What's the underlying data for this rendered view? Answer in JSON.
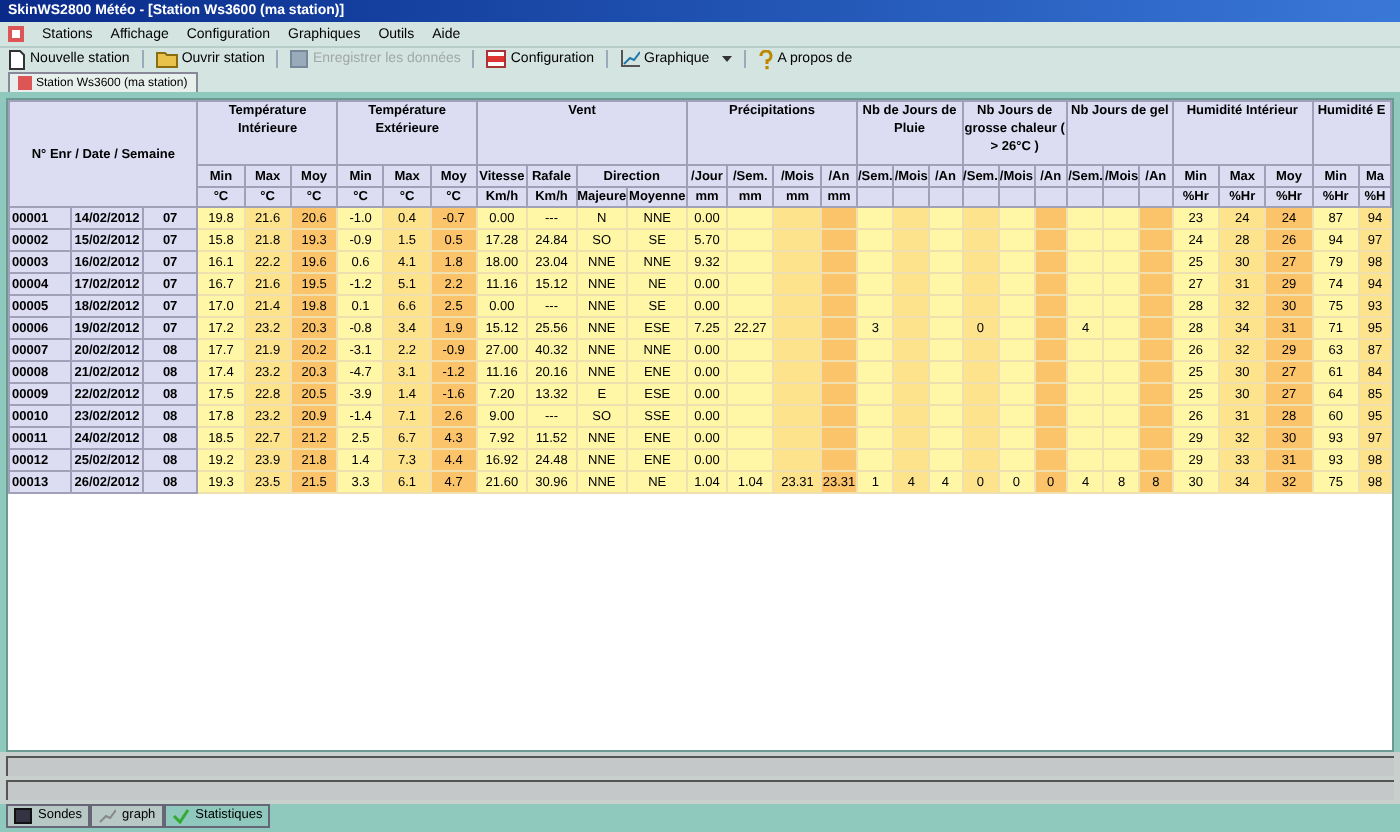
{
  "window": {
    "title": "SkinWS2800 Météo - [Station Ws3600 (ma station)]"
  },
  "menu": [
    "Stations",
    "Affichage",
    "Configuration",
    "Graphiques",
    "Outils",
    "Aide"
  ],
  "toolbar": [
    {
      "kind": "new",
      "label": "Nouvelle station",
      "disabled": false
    },
    {
      "kind": "open",
      "label": "Ouvrir station",
      "disabled": false
    },
    {
      "kind": "save",
      "label": "Enregistrer les données",
      "disabled": true
    },
    {
      "kind": "config",
      "label": "Configuration",
      "disabled": false
    },
    {
      "kind": "chart",
      "label": "Graphique",
      "disabled": false,
      "dropdown": true
    },
    {
      "kind": "help",
      "label": "A propos de",
      "disabled": false
    }
  ],
  "document_tab": "Station Ws3600 (ma station)",
  "table": {
    "id_header": "N° Enr / Date / Semaine",
    "groups": [
      {
        "title": "Température Intérieure",
        "columns": [
          {
            "label": "Min",
            "unit": "°C",
            "color": "#fff7a6"
          },
          {
            "label": "Max",
            "unit": "°C",
            "color": "#fde48c"
          },
          {
            "label": "Moy",
            "unit": "°C",
            "color": "#fbc36a"
          }
        ]
      },
      {
        "title": "Température Extérieure",
        "columns": [
          {
            "label": "Min",
            "unit": "°C",
            "color": "#fff7a6"
          },
          {
            "label": "Max",
            "unit": "°C",
            "color": "#fde48c"
          },
          {
            "label": "Moy",
            "unit": "°C",
            "color": "#fbc36a"
          }
        ]
      },
      {
        "title": "Vent",
        "columns": [
          {
            "label": "Vitesse",
            "unit": "Km/h",
            "color": "#fff7a6"
          },
          {
            "label": "Rafale",
            "unit": "Km/h",
            "color": "#fff7a6"
          },
          {
            "label": "Majeure",
            "span_label": "Direction",
            "color": "#fff7a6"
          },
          {
            "label": "Moyenne",
            "color": "#fff7a6"
          }
        ]
      },
      {
        "title": "Précipitations",
        "columns": [
          {
            "label": "/Jour",
            "unit": "mm",
            "color": "#fff7a6"
          },
          {
            "label": "/Sem.",
            "unit": "mm",
            "color": "#fff7a6"
          },
          {
            "label": "/Mois",
            "unit": "mm",
            "color": "#fde48c"
          },
          {
            "label": "/An",
            "unit": "mm",
            "color": "#fbc36a"
          }
        ]
      },
      {
        "title": "Nb de Jours de Pluie",
        "columns": [
          {
            "label": "/Sem.",
            "color": "#fff7a6"
          },
          {
            "label": "/Mois",
            "color": "#fde48c"
          },
          {
            "label": "/An",
            "color": "#fff7a6"
          }
        ]
      },
      {
        "title": "Nb Jours de grosse chaleur ( > 26°C )",
        "columns": [
          {
            "label": "/Sem.",
            "color": "#fde48c"
          },
          {
            "label": "/Mois",
            "color": "#fff7a6"
          },
          {
            "label": "/An",
            "color": "#fbc36a"
          }
        ]
      },
      {
        "title": "Nb Jours de gel",
        "columns": [
          {
            "label": "/Sem.",
            "color": "#fff7a6"
          },
          {
            "label": "/Mois",
            "color": "#fff7a6"
          },
          {
            "label": "/An",
            "color": "#fbc36a"
          }
        ]
      },
      {
        "title": "Humidité Intérieur",
        "columns": [
          {
            "label": "Min",
            "unit": "%Hr",
            "color": "#fff7a6"
          },
          {
            "label": "Max",
            "unit": "%Hr",
            "color": "#fde48c"
          },
          {
            "label": "Moy",
            "unit": "%Hr",
            "color": "#fbc36a"
          }
        ]
      },
      {
        "title": "Humidité E",
        "columns": [
          {
            "label": "Min",
            "unit": "%Hr",
            "color": "#fff7a6"
          },
          {
            "label": "Ma",
            "unit": "%H",
            "color": "#fde48c"
          }
        ]
      }
    ],
    "rows": [
      {
        "id": "00001",
        "date": "14/02/2012",
        "week": "07",
        "values": [
          "19.8",
          "21.6",
          "20.6",
          "-1.0",
          "0.4",
          "-0.7",
          "0.00",
          "---",
          "N",
          "NNE",
          "0.00",
          {
            "kind": "blank"
          },
          {
            "kind": "blank"
          },
          {
            "kind": "blank"
          },
          {
            "kind": "blank"
          },
          {
            "kind": "blank"
          },
          {
            "kind": "blank"
          },
          {
            "kind": "blank"
          },
          {
            "kind": "blank"
          },
          {
            "kind": "blank"
          },
          {
            "kind": "blank"
          },
          {
            "kind": "blank"
          },
          {
            "kind": "blank"
          },
          "23",
          "24",
          "24",
          "87",
          "94"
        ]
      },
      {
        "id": "00002",
        "date": "15/02/2012",
        "week": "07",
        "values": [
          "15.8",
          "21.8",
          "19.3",
          "-0.9",
          "1.5",
          "0.5",
          "17.28",
          "24.84",
          "SO",
          "SE",
          "5.70",
          {
            "kind": "blank"
          },
          {
            "kind": "blank"
          },
          {
            "kind": "blank"
          },
          {
            "kind": "blank"
          },
          {
            "kind": "blank"
          },
          {
            "kind": "blank"
          },
          {
            "kind": "blank"
          },
          {
            "kind": "blank"
          },
          {
            "kind": "blank"
          },
          {
            "kind": "blank"
          },
          {
            "kind": "blank"
          },
          {
            "kind": "blank"
          },
          "24",
          "28",
          "26",
          "94",
          "97"
        ]
      },
      {
        "id": "00003",
        "date": "16/02/2012",
        "week": "07",
        "values": [
          "16.1",
          "22.2",
          "19.6",
          "0.6",
          "4.1",
          "1.8",
          "18.00",
          "23.04",
          "NNE",
          "NNE",
          "9.32",
          {
            "kind": "blank"
          },
          {
            "kind": "blank"
          },
          {
            "kind": "blank"
          },
          {
            "kind": "blank"
          },
          {
            "kind": "blank"
          },
          {
            "kind": "blank"
          },
          {
            "kind": "blank"
          },
          {
            "kind": "blank"
          },
          {
            "kind": "blank"
          },
          {
            "kind": "blank"
          },
          {
            "kind": "blank"
          },
          {
            "kind": "blank"
          },
          "25",
          "30",
          "27",
          "79",
          "98"
        ]
      },
      {
        "id": "00004",
        "date": "17/02/2012",
        "week": "07",
        "values": [
          "16.7",
          "21.6",
          "19.5",
          "-1.2",
          "5.1",
          "2.2",
          "11.16",
          "15.12",
          "NNE",
          "NE",
          "0.00",
          {
            "kind": "blank"
          },
          {
            "kind": "blank"
          },
          {
            "kind": "blank"
          },
          {
            "kind": "blank"
          },
          {
            "kind": "blank"
          },
          {
            "kind": "blank"
          },
          {
            "kind": "blank"
          },
          {
            "kind": "blank"
          },
          {
            "kind": "blank"
          },
          {
            "kind": "blank"
          },
          {
            "kind": "blank"
          },
          {
            "kind": "blank"
          },
          "27",
          "31",
          "29",
          "74",
          "94"
        ]
      },
      {
        "id": "00005",
        "date": "18/02/2012",
        "week": "07",
        "values": [
          "17.0",
          "21.4",
          "19.8",
          "0.1",
          "6.6",
          "2.5",
          "0.00",
          "---",
          "NNE",
          "SE",
          "0.00",
          {
            "kind": "blank"
          },
          {
            "kind": "blank"
          },
          {
            "kind": "blank"
          },
          {
            "kind": "blank"
          },
          {
            "kind": "blank"
          },
          {
            "kind": "blank"
          },
          {
            "kind": "blank"
          },
          {
            "kind": "blank"
          },
          {
            "kind": "blank"
          },
          {
            "kind": "blank"
          },
          {
            "kind": "blank"
          },
          {
            "kind": "blank"
          },
          "28",
          "32",
          "30",
          "75",
          "93"
        ]
      },
      {
        "id": "00006",
        "date": "19/02/2012",
        "week": "07",
        "values": [
          "17.2",
          "23.2",
          "20.3",
          "-0.8",
          "3.4",
          "1.9",
          "15.12",
          "25.56",
          "NNE",
          "ESE",
          "7.25",
          "22.27",
          {
            "kind": "blank"
          },
          {
            "kind": "blank"
          },
          "3",
          {
            "kind": "blank"
          },
          {
            "kind": "blank"
          },
          "0",
          {
            "kind": "blank"
          },
          {
            "kind": "blank"
          },
          "4",
          {
            "kind": "blank"
          },
          {
            "kind": "blank"
          },
          "28",
          "34",
          "31",
          "71",
          "95"
        ]
      },
      {
        "id": "00007",
        "date": "20/02/2012",
        "week": "08",
        "values": [
          "17.7",
          "21.9",
          "20.2",
          "-3.1",
          "2.2",
          "-0.9",
          "27.00",
          "40.32",
          "NNE",
          "NNE",
          "0.00",
          {
            "kind": "blank"
          },
          {
            "kind": "blank"
          },
          {
            "kind": "blank"
          },
          {
            "kind": "blank"
          },
          {
            "kind": "blank"
          },
          {
            "kind": "blank"
          },
          {
            "kind": "blank"
          },
          {
            "kind": "blank"
          },
          {
            "kind": "blank"
          },
          {
            "kind": "blank"
          },
          {
            "kind": "blank"
          },
          {
            "kind": "blank"
          },
          "26",
          "32",
          "29",
          "63",
          "87"
        ]
      },
      {
        "id": "00008",
        "date": "21/02/2012",
        "week": "08",
        "values": [
          "17.4",
          "23.2",
          "20.3",
          "-4.7",
          "3.1",
          "-1.2",
          "11.16",
          "20.16",
          "NNE",
          "ENE",
          "0.00",
          {
            "kind": "blank"
          },
          {
            "kind": "blank"
          },
          {
            "kind": "blank"
          },
          {
            "kind": "blank"
          },
          {
            "kind": "blank"
          },
          {
            "kind": "blank"
          },
          {
            "kind": "blank"
          },
          {
            "kind": "blank"
          },
          {
            "kind": "blank"
          },
          {
            "kind": "blank"
          },
          {
            "kind": "blank"
          },
          {
            "kind": "blank"
          },
          "25",
          "30",
          "27",
          "61",
          "84"
        ]
      },
      {
        "id": "00009",
        "date": "22/02/2012",
        "week": "08",
        "values": [
          "17.5",
          "22.8",
          "20.5",
          "-3.9",
          "1.4",
          "-1.6",
          "7.20",
          "13.32",
          "E",
          "ESE",
          "0.00",
          {
            "kind": "blank"
          },
          {
            "kind": "blank"
          },
          {
            "kind": "blank"
          },
          {
            "kind": "blank"
          },
          {
            "kind": "blank"
          },
          {
            "kind": "blank"
          },
          {
            "kind": "blank"
          },
          {
            "kind": "blank"
          },
          {
            "kind": "blank"
          },
          {
            "kind": "blank"
          },
          {
            "kind": "blank"
          },
          {
            "kind": "blank"
          },
          "25",
          "30",
          "27",
          "64",
          "85"
        ]
      },
      {
        "id": "00010",
        "date": "23/02/2012",
        "week": "08",
        "values": [
          "17.8",
          "23.2",
          "20.9",
          "-1.4",
          "7.1",
          "2.6",
          "9.00",
          "---",
          "SO",
          "SSE",
          "0.00",
          {
            "kind": "blank"
          },
          {
            "kind": "blank"
          },
          {
            "kind": "blank"
          },
          {
            "kind": "blank"
          },
          {
            "kind": "blank"
          },
          {
            "kind": "blank"
          },
          {
            "kind": "blank"
          },
          {
            "kind": "blank"
          },
          {
            "kind": "blank"
          },
          {
            "kind": "blank"
          },
          {
            "kind": "blank"
          },
          {
            "kind": "blank"
          },
          "26",
          "31",
          "28",
          "60",
          "95"
        ]
      },
      {
        "id": "00011",
        "date": "24/02/2012",
        "week": "08",
        "values": [
          "18.5",
          "22.7",
          "21.2",
          "2.5",
          "6.7",
          "4.3",
          "7.92",
          "11.52",
          "NNE",
          "ENE",
          "0.00",
          {
            "kind": "blank"
          },
          {
            "kind": "blank"
          },
          {
            "kind": "blank"
          },
          {
            "kind": "blank"
          },
          {
            "kind": "blank"
          },
          {
            "kind": "blank"
          },
          {
            "kind": "blank"
          },
          {
            "kind": "blank"
          },
          {
            "kind": "blank"
          },
          {
            "kind": "blank"
          },
          {
            "kind": "blank"
          },
          {
            "kind": "blank"
          },
          "29",
          "32",
          "30",
          "93",
          "97"
        ]
      },
      {
        "id": "00012",
        "date": "25/02/2012",
        "week": "08",
        "values": [
          "19.2",
          "23.9",
          "21.8",
          "1.4",
          "7.3",
          "4.4",
          "16.92",
          "24.48",
          "NNE",
          "ENE",
          "0.00",
          {
            "kind": "blank"
          },
          {
            "kind": "blank"
          },
          {
            "kind": "blank"
          },
          {
            "kind": "blank"
          },
          {
            "kind": "blank"
          },
          {
            "kind": "blank"
          },
          {
            "kind": "blank"
          },
          {
            "kind": "blank"
          },
          {
            "kind": "blank"
          },
          {
            "kind": "blank"
          },
          {
            "kind": "blank"
          },
          {
            "kind": "blank"
          },
          "29",
          "33",
          "31",
          "93",
          "98"
        ]
      },
      {
        "id": "00013",
        "date": "26/02/2012",
        "week": "08",
        "values": [
          "19.3",
          "23.5",
          "21.5",
          "3.3",
          "6.1",
          "4.7",
          "21.60",
          "30.96",
          "NNE",
          "NE",
          "1.04",
          "1.04",
          "23.31",
          "23.31",
          "1",
          "4",
          "4",
          "0",
          "0",
          "0",
          "4",
          "8",
          "8",
          "30",
          "34",
          "32",
          "75",
          "98"
        ]
      }
    ]
  },
  "bottom_tabs": [
    {
      "kind": "probes",
      "label": "Sondes",
      "selected": false
    },
    {
      "kind": "graph",
      "label": "graph",
      "selected": false
    },
    {
      "kind": "stats",
      "label": "Statistiques",
      "selected": true
    }
  ]
}
